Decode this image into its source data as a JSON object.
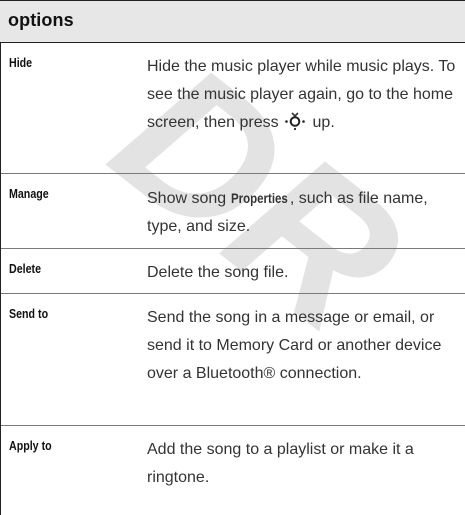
{
  "watermark": "DR",
  "table": {
    "header": "options",
    "rows": [
      {
        "label": "Hide",
        "desc_part1": "Hide the music player while music plays. To see the music player again, go to the home screen, then press",
        "icon": "navigation-key-up-icon",
        "desc_part2": "up."
      },
      {
        "label": "Manage",
        "desc_part1": "Show song",
        "desc_strong": "Properties",
        "desc_part2": ", such as file name, type, and size."
      },
      {
        "label": "Delete",
        "desc": "Delete the song file."
      },
      {
        "label": "Send to",
        "desc": "Send the song in a message or email, or send it to Memory Card or another device over a Bluetooth® connection."
      },
      {
        "label": "Apply to",
        "desc": "Add the song to a playlist or make it a ringtone."
      }
    ]
  }
}
